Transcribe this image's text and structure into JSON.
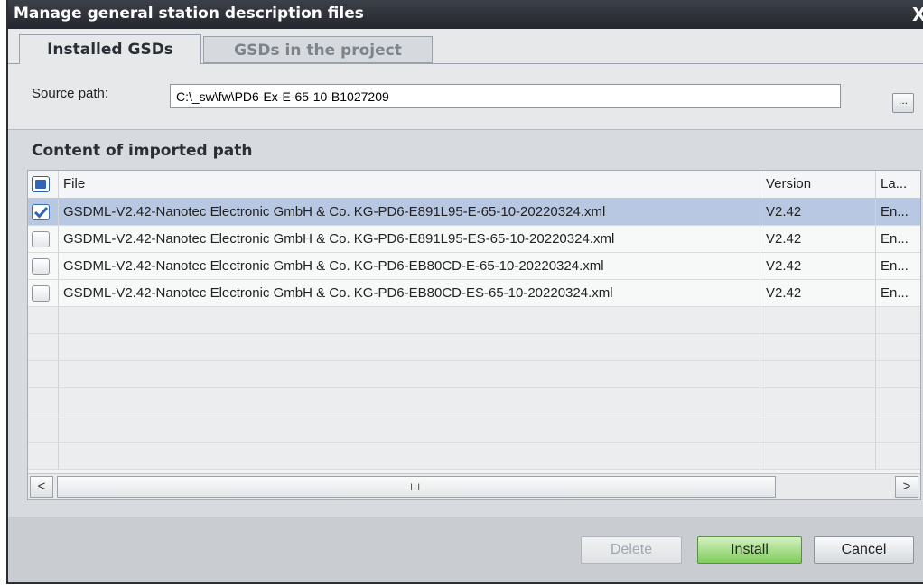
{
  "dialog": {
    "title": "Manage general station description files",
    "close_glyph": "X"
  },
  "tabs": [
    {
      "label": "Installed GSDs",
      "active": true
    },
    {
      "label": "GSDs in the project",
      "active": false
    }
  ],
  "source": {
    "label": "Source path:",
    "value": "C:\\_sw\\fw\\PD6-Ex-E-65-10-B1027209",
    "browse_label": "..."
  },
  "content": {
    "title": "Content of imported path",
    "columns": {
      "file": "File",
      "version": "Version",
      "language": "La..."
    },
    "header_checkbox_state": "partial",
    "rows": [
      {
        "checked": true,
        "file": "GSDML-V2.42-Nanotec Electronic GmbH & Co. KG-PD6-E891L95-E-65-10-20220324.xml",
        "version": "V2.42",
        "language": "En..."
      },
      {
        "checked": false,
        "file": "GSDML-V2.42-Nanotec Electronic GmbH & Co. KG-PD6-E891L95-ES-65-10-20220324.xml",
        "version": "V2.42",
        "language": "En..."
      },
      {
        "checked": false,
        "file": "GSDML-V2.42-Nanotec Electronic GmbH & Co. KG-PD6-EB80CD-E-65-10-20220324.xml",
        "version": "V2.42",
        "language": "En..."
      },
      {
        "checked": false,
        "file": "GSDML-V2.42-Nanotec Electronic GmbH & Co. KG-PD6-EB80CD-ES-65-10-20220324.xml",
        "version": "V2.42",
        "language": "En..."
      }
    ]
  },
  "scrollbar": {
    "left_glyph": "<",
    "right_glyph": ">",
    "grip_glyph": "III"
  },
  "buttons": {
    "delete": "Delete",
    "install": "Install",
    "cancel": "Cancel"
  },
  "colors": {
    "titlebar": "#2e3138",
    "selected_row": "#b8c7e2",
    "install_button": "#7fcc5c",
    "checkbox_accent": "#2f64b8"
  },
  "icons": {
    "close": "close-icon",
    "check": "checkmark-icon",
    "browse": "ellipsis-icon"
  }
}
